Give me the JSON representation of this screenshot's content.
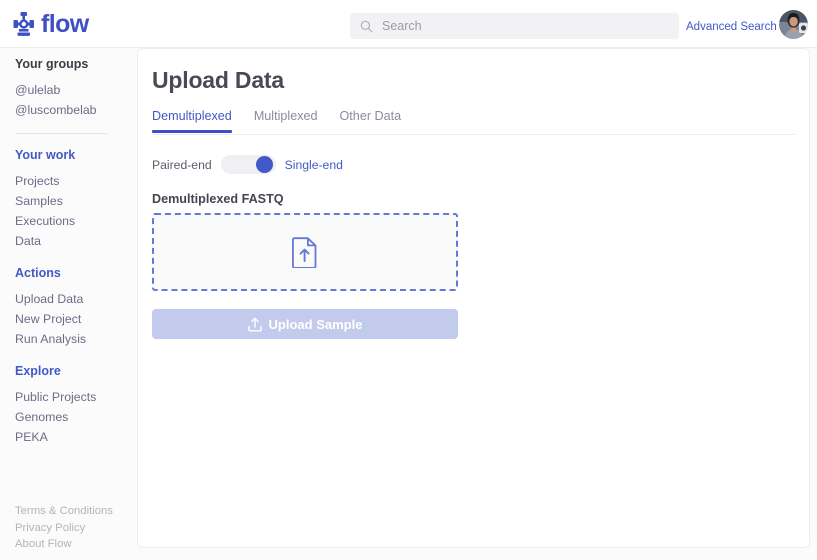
{
  "header": {
    "logo_text": "flow",
    "logo_icon": "flow-valve-logo-icon",
    "search": {
      "placeholder": "Search",
      "value": "",
      "icon": "search-icon"
    },
    "advanced_search_label": "Advanced Search",
    "avatar_alt": "user-avatar"
  },
  "sidebar": {
    "groups_heading": "Your groups",
    "groups": [
      {
        "label": "@ulelab"
      },
      {
        "label": "@luscombelab"
      }
    ],
    "sections": [
      {
        "heading": "Your work",
        "items": [
          {
            "label": "Projects"
          },
          {
            "label": "Samples"
          },
          {
            "label": "Executions"
          },
          {
            "label": "Data"
          }
        ]
      },
      {
        "heading": "Actions",
        "items": [
          {
            "label": "Upload Data"
          },
          {
            "label": "New Project"
          },
          {
            "label": "Run Analysis"
          }
        ]
      },
      {
        "heading": "Explore",
        "items": [
          {
            "label": "Public Projects"
          },
          {
            "label": "Genomes"
          },
          {
            "label": "PEKA"
          }
        ]
      }
    ],
    "footer_links": [
      {
        "label": "Terms & Conditions"
      },
      {
        "label": "Privacy Policy"
      },
      {
        "label": "About Flow"
      }
    ]
  },
  "main": {
    "title": "Upload Data",
    "tabs": [
      {
        "label": "Demultiplexed",
        "active": true
      },
      {
        "label": "Multiplexed",
        "active": false
      },
      {
        "label": "Other Data",
        "active": false
      }
    ],
    "read_type_toggle": {
      "left_label": "Paired-end",
      "right_label": "Single-end",
      "selected": "Single-end"
    },
    "dropzone": {
      "label": "Demultiplexed FASTQ",
      "icon": "file-upload-icon",
      "text": ""
    },
    "upload_button": {
      "label": "Upload Sample",
      "icon": "upload-tray-icon",
      "disabled": true
    }
  },
  "colors": {
    "brand_blue": "#3f51c0",
    "link_blue": "#4459c8",
    "dashed_border": "#6478d4",
    "button_disabled": "#c3cbec",
    "muted_text": "#b3b4bd",
    "page_bg": "#fbfbfc"
  }
}
